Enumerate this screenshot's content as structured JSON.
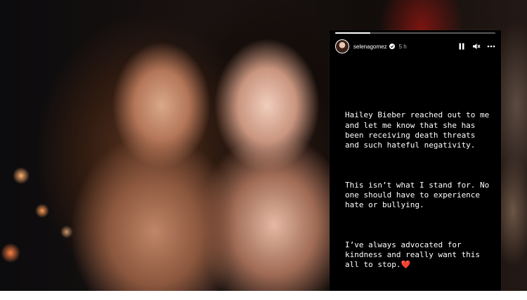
{
  "story": {
    "username": "selenagomez",
    "time": "5 h",
    "progress": 0.22,
    "paragraphs": [
      "Hailey Bieber reached out to me and let me know that she has been receiving death threats and such hateful negativity.",
      "This isn’t what I stand for. No one should have to experience hate or bullying.",
      "I’ve always advocated for kindness and really want this all to stop."
    ],
    "heart_emoji": "❤️"
  },
  "icons": {
    "verified": "verified-badge-icon",
    "pause": "pause-icon",
    "mute": "mute-icon",
    "more": "more-options-icon"
  },
  "colors": {
    "story_bg": "#000000",
    "text": "#ffffff",
    "heart": "#e36a3a"
  }
}
